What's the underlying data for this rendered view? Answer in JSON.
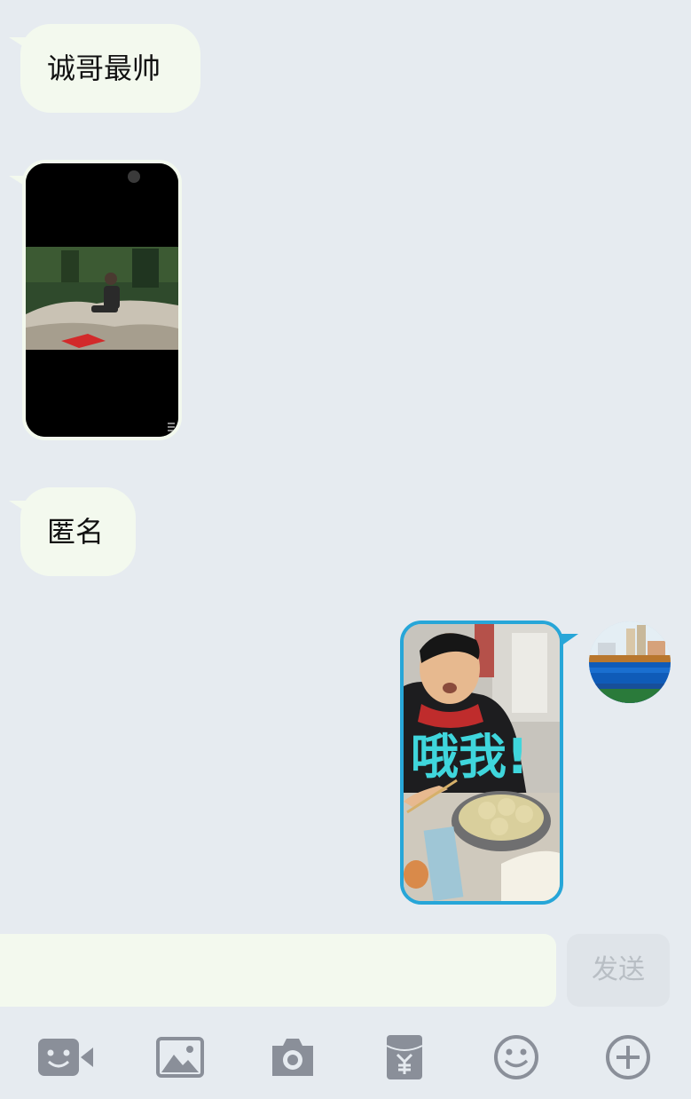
{
  "messages": [
    {
      "side": "left",
      "type": "text",
      "text": "诚哥最帅"
    },
    {
      "side": "left",
      "type": "image",
      "subject": "person-sitting-on-rocks-photo"
    },
    {
      "side": "left",
      "type": "text",
      "text": "匿名"
    },
    {
      "side": "right",
      "type": "image",
      "subject": "selfie-with-dumplings-photo",
      "handwriting": "哦我!"
    }
  ],
  "composer": {
    "input_value": "",
    "send_label": "发送"
  },
  "toolbar": {
    "icons": [
      "video-call-icon",
      "image-gallery-icon",
      "camera-icon",
      "red-packet-icon",
      "emoji-icon",
      "plus-icon"
    ]
  },
  "colors": {
    "background": "#e6ebf0",
    "bubble": "#f3f9ee",
    "my_bubble_border": "#27a6d8",
    "icon_gray": "#8a8f99"
  }
}
